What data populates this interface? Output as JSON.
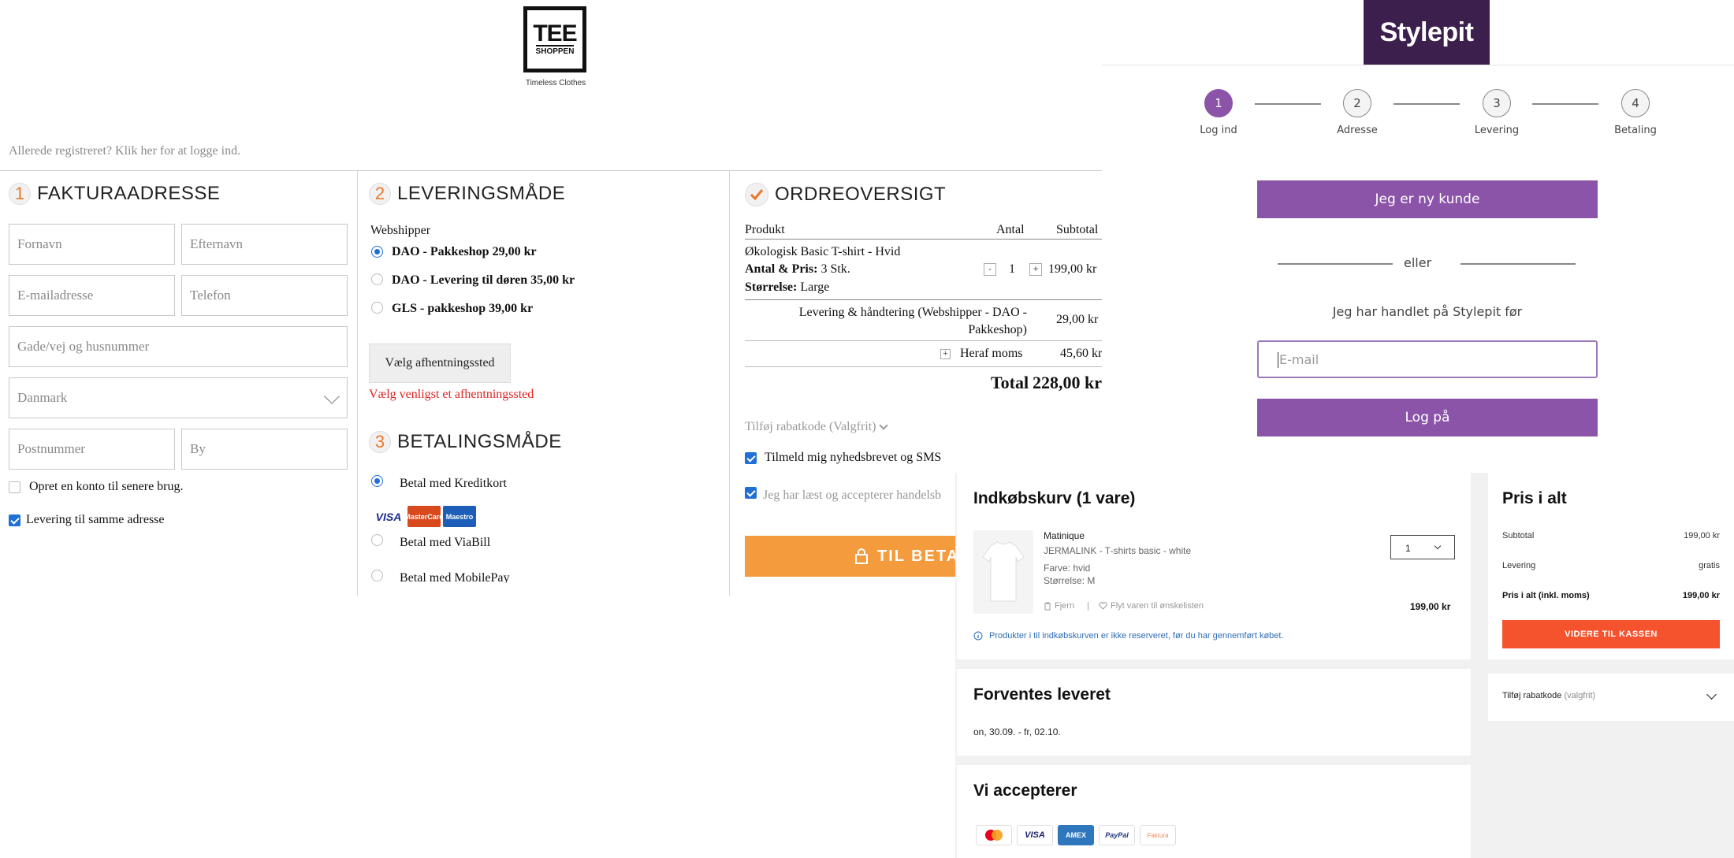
{
  "tee": {
    "logo": {
      "line1": "TEE",
      "line2": "SHOPPEN",
      "tagline": "Timeless Clothes"
    },
    "login_link": "Allerede registreret? Klik her for at logge ind.",
    "billing": {
      "number": "1",
      "title": "FAKTURAADRESSE",
      "fields": {
        "first_name": "Fornavn",
        "last_name": "Efternavn",
        "email": "E-mailadresse",
        "phone": "Telefon",
        "street": "Gade/vej og husnummer",
        "country": "Danmark",
        "zip": "Postnummer",
        "city": "By"
      },
      "create_account": "Opret en konto til senere brug.",
      "same_address": "Levering til samme adresse"
    },
    "shipping": {
      "number": "2",
      "title": "LEVERINGSMÅDE",
      "group_label": "Webshipper",
      "options": [
        "DAO - Pakkeshop 29,00 kr",
        "DAO - Levering til døren 35,00 kr",
        "GLS - pakkeshop 39,00 kr"
      ],
      "pickup_button": "Vælg afhentningssted",
      "pickup_error": "Vælg venligst et afhentningssted"
    },
    "payment": {
      "number": "3",
      "title": "BETALINGSMÅDE",
      "options": [
        "Betal med Kreditkort",
        "Betal med ViaBill",
        "Betal med MobilePay"
      ],
      "cards": [
        "VISA",
        "MasterCard",
        "Maestro"
      ]
    },
    "order": {
      "title": "ORDREOVERSIGT",
      "headers": {
        "product": "Produkt",
        "qty": "Antal",
        "subtotal": "Subtotal"
      },
      "item_name": "Økologisk Basic T-shirt - Hvid",
      "item_qty_label": "Antal & Pris:",
      "item_qty_value": "3 Stk.",
      "item_size_label": "Størrelse:",
      "item_size_value": "Large",
      "item_qty": "1",
      "item_minus": "-",
      "item_plus": "+",
      "item_subtotal": "199,00 kr",
      "shipping_label": "Levering & håndtering (Webshipper - DAO - Pakkeshop)",
      "shipping_value": "29,00 kr",
      "vat_expand": "+",
      "vat_label": "Heraf moms",
      "vat_value": "45,60 kr",
      "total_label": "Total",
      "total_value": "228,00 kr",
      "discount": "Tilføj rabatkode (Valgfrit)",
      "newsletter": "Tilmeld mig nyhedsbrevet og SMS",
      "terms": "Jeg har læst og accepterer handelsb",
      "checkout_button": "TIL BETAL"
    }
  },
  "stylepit": {
    "logo": "Stylepit",
    "steps": [
      {
        "num": "1",
        "label": "Log ind"
      },
      {
        "num": "2",
        "label": "Adresse"
      },
      {
        "num": "3",
        "label": "Levering"
      },
      {
        "num": "4",
        "label": "Betaling"
      }
    ],
    "new_customer": "Jeg er ny kunde",
    "or": "eller",
    "returning": "Jeg har handlet på Stylepit før",
    "email_placeholder": "E-mail",
    "login_button": "Log på"
  },
  "matinique": {
    "cart_title": "Indkøbskurv (1 vare)",
    "item": {
      "brand": "Matinique",
      "name": "JERMALINK - T-shirts basic - white",
      "color": "Farve: hvid",
      "size": "Størrelse: M",
      "qty": "1",
      "remove": "Fjern",
      "separator": "|",
      "wishlist": "Flyt varen til ønskelisten",
      "price": "199,00 kr"
    },
    "notice": "Produkter i til indkøbskurven er ikke reserveret, før du har gennemført købet.",
    "delivery_title": "Forventes leveret",
    "delivery_dates": "on, 30.09. - fr, 02.10.",
    "accept_title": "Vi accepterer",
    "payment_methods": [
      "Mastercard",
      "VISA",
      "AMEX",
      "PayPal",
      "Faktura"
    ],
    "summary": {
      "title": "Pris i alt",
      "subtotal_label": "Subtotal",
      "subtotal_value": "199,00 kr",
      "delivery_label": "Levering",
      "delivery_value": "gratis",
      "total_label": "Pris i alt (inkl. moms)",
      "total_value": "199,00 kr",
      "checkout_button": "VIDERE TIL KASSEN",
      "discount": "Tilføj rabatkode",
      "discount_optional": "(valgfrit)"
    },
    "colors": {
      "accent": "#f4532e"
    }
  }
}
